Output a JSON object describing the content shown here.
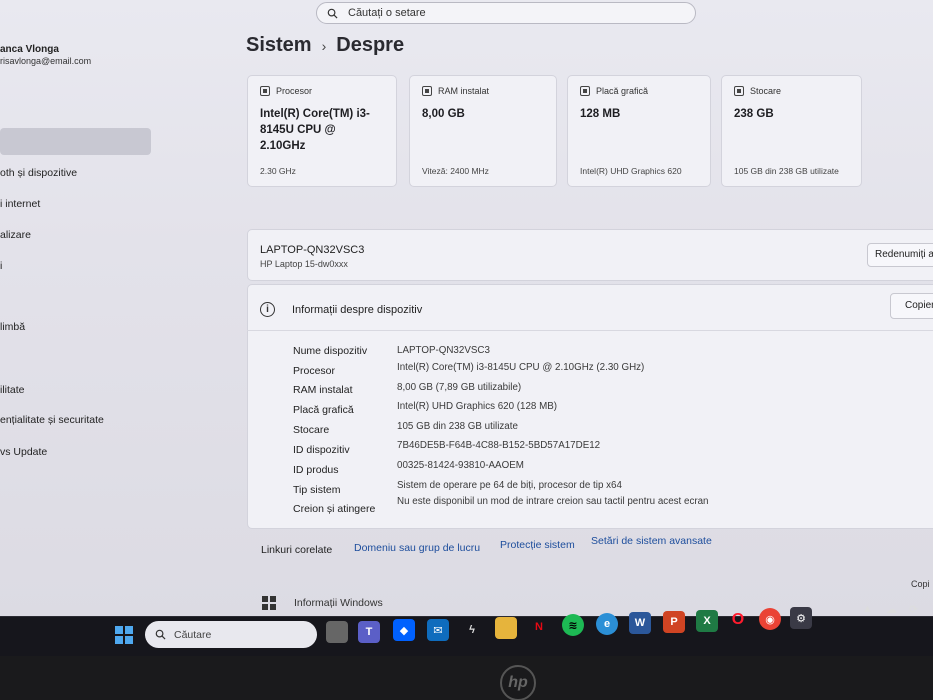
{
  "search": {
    "placeholder": "Căutați o setare"
  },
  "user": {
    "name": "anca Vlonga",
    "email": "risavlonga@email.com"
  },
  "sidebar": {
    "items": [
      {
        "label": "oth și dispozitive"
      },
      {
        "label": "i internet"
      },
      {
        "label": "alizare"
      },
      {
        "label": "i"
      },
      {
        "label": "limbă"
      },
      {
        "label": "ilitate"
      },
      {
        "label": "ențialitate și securitate"
      },
      {
        "label": "vs Update"
      }
    ]
  },
  "breadcrumb": {
    "parent": "Sistem",
    "separator": "›",
    "current": "Despre"
  },
  "cards": [
    {
      "title": "Procesor",
      "value": "Intel(R) Core(TM) i3-8145U CPU @ 2.10GHz",
      "sub": "2.30 GHz"
    },
    {
      "title": "RAM instalat",
      "value": "8,00 GB",
      "sub": "Viteză: 2400 MHz"
    },
    {
      "title": "Placă grafică",
      "value": "128 MB",
      "sub": "Intel(R) UHD Graphics 620"
    },
    {
      "title": "Stocare",
      "value": "238 GB",
      "sub": "105 GB din 238 GB utilizate"
    }
  ],
  "device": {
    "name": "LAPTOP-QN32VSC3",
    "model": "HP Laptop 15-dw0xxx",
    "rename_label": "Redenumiți ac"
  },
  "info": {
    "title": "Informații despre dispozitiv",
    "copy_label": "Copier",
    "specs": [
      {
        "label": "Nume dispozitiv",
        "value": "LAPTOP-QN32VSC3"
      },
      {
        "label": "Procesor",
        "value": "Intel(R) Core(TM) i3-8145U CPU @ 2.10GHz (2.30 GHz)"
      },
      {
        "label": "RAM instalat",
        "value": "8,00 GB (7,89 GB utilizabile)"
      },
      {
        "label": "Placă grafică",
        "value": "Intel(R) UHD Graphics 620 (128 MB)"
      },
      {
        "label": "Stocare",
        "value": "105 GB din 238 GB utilizate"
      },
      {
        "label": "ID dispozitiv",
        "value": "7B46DE5B-F64B-4C88-B152-5BD57A17DE12"
      },
      {
        "label": "ID produs",
        "value": "00325-81424-93810-AAOEM"
      },
      {
        "label": "Tip sistem",
        "value": "Sistem de operare pe 64 de biți, procesor de tip x64"
      },
      {
        "label": "Creion și atingere",
        "value": "Nu este disponibil un mod de intrare creion sau tactil pentru acest ecran"
      }
    ]
  },
  "related": {
    "label": "Linkuri corelate",
    "links": [
      "Domeniu sau grup de lucru",
      "Protecție sistem",
      "Setări de sistem avansate"
    ]
  },
  "windows_info": {
    "label": "Informații Windows",
    "copy_small": "Copi"
  },
  "taskbar": {
    "search_placeholder": "Căutare",
    "apps": [
      "task-view-icon",
      "teams-icon",
      "dropbox-icon",
      "mail-icon",
      "tidal-icon",
      "explorer-icon",
      "netflix-icon",
      "spotify-icon",
      "edge-icon",
      "word-icon",
      "powerpoint-icon",
      "excel-icon",
      "opera-icon",
      "chrome-icon",
      "settings-icon"
    ]
  },
  "brand": "hp"
}
